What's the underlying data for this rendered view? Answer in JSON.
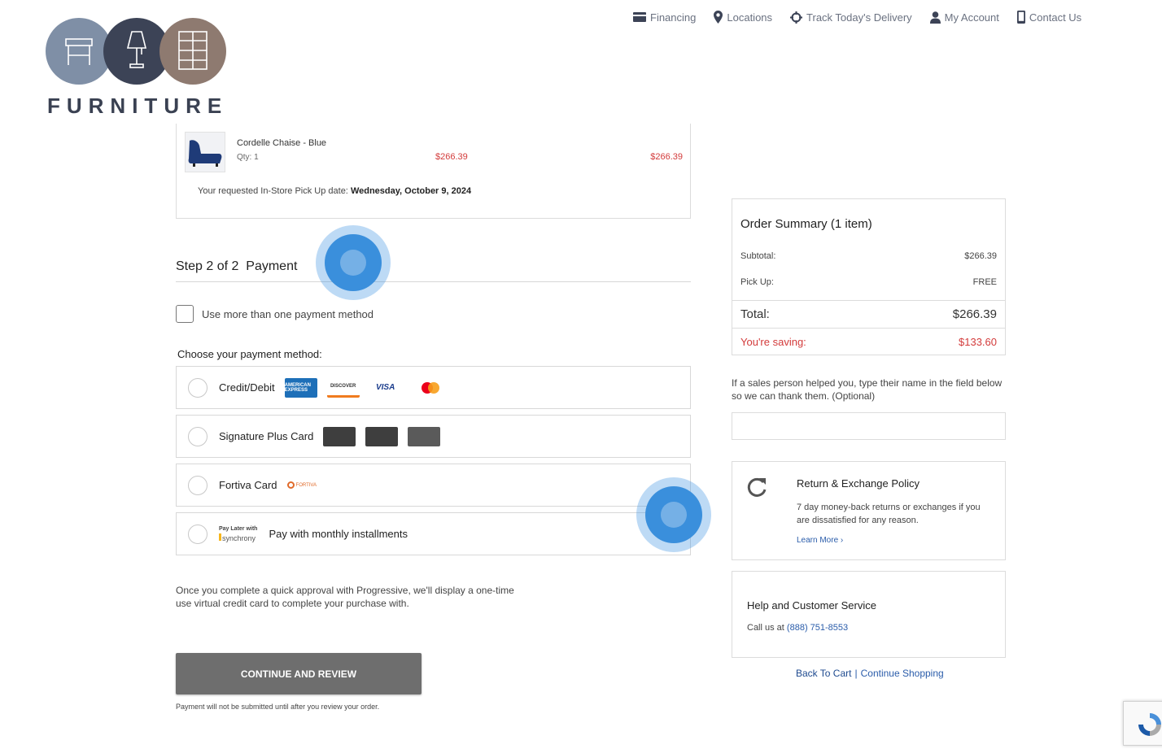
{
  "brand": {
    "wordmark": "FURNITURE"
  },
  "nav": [
    {
      "label": "Financing",
      "icon": "credit-card-icon"
    },
    {
      "label": "Locations",
      "icon": "map-pin-icon"
    },
    {
      "label": "Track Today's Delivery",
      "icon": "crosshair-icon"
    },
    {
      "label": "My Account",
      "icon": "user-icon"
    },
    {
      "label": "Contact Us",
      "icon": "phone-icon"
    }
  ],
  "cart_item": {
    "name": "Cordelle Chaise - Blue",
    "qty": "Qty: 1",
    "price": "$266.39",
    "total": "$266.39",
    "pickup_label": "Your requested In-Store Pick Up date:",
    "pickup_date": "Wednesday, October 9, 2024"
  },
  "step": {
    "title": "Step 2 of 2  Payment",
    "multi_label": "Use more than one payment method",
    "choose_label": "Choose your payment method:"
  },
  "payment_options": [
    {
      "label": "Credit/Debit",
      "logos": [
        "AMERICAN EXPRESS",
        "DISCOVER",
        "VISA",
        "mastercard"
      ]
    },
    {
      "label": "Signature Plus Card"
    },
    {
      "label": "Fortiva Card",
      "logo_text": "FORTIVA"
    },
    {
      "label": "Pay with monthly installments",
      "logo_top": "Pay Later with",
      "logo_bottom": "synchrony"
    }
  ],
  "progressive_note": "Once you complete a quick approval with Progressive, we'll display a one-time use virtual credit card to complete your purchase with.",
  "continue_button": "CONTINUE AND REVIEW",
  "submit_note": "Payment will not be submitted until after you review your order.",
  "summary": {
    "title": "Order Summary (1 item)",
    "subtotal_label": "Subtotal:",
    "subtotal": "$266.39",
    "pickup_label": "Pick Up:",
    "pickup": "FREE",
    "total_label": "Total:",
    "total": "$266.39",
    "saving_label": "You're saving:",
    "saving": "$133.60"
  },
  "salesperson_note": "If a sales person helped you, type their name in the field below so we can thank them. (Optional)",
  "policy": {
    "title": "Return & Exchange Policy",
    "text": "7 day money-back returns or exchanges if you are dissatisfied for any reason.",
    "link": "Learn More ›"
  },
  "help": {
    "title": "Help and Customer Service",
    "call_label": "Call us at",
    "phone": "(888) 751-8553"
  },
  "links": {
    "back": "Back To Cart",
    "sep": "|",
    "continue": "Continue Shopping"
  },
  "colors": {
    "accent_red": "#d33b3b",
    "link_blue": "#2a5caa",
    "button_gray": "#6e6e6e",
    "click_blue": "#3a8fdc"
  }
}
